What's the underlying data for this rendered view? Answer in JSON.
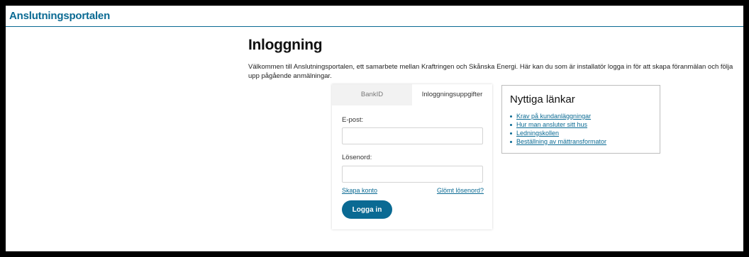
{
  "header": {
    "brand": "Anslutningsportalen"
  },
  "main": {
    "title": "Inloggning",
    "intro": "Välkommen till Anslutningsportalen, ett samarbete mellan Kraftringen och Skånska Energi. Här kan du som är installatör logga in för att skapa föranmälan och följa upp pågående anmälningar."
  },
  "login": {
    "tabs": [
      "BankID",
      "Inloggningsuppgifter"
    ],
    "active_tab": "Inloggningsuppgifter",
    "email_label": "E-post:",
    "email_value": "",
    "password_label": "Lösenord:",
    "password_value": "",
    "create_account": "Skapa konto",
    "forgot_password": "Glömt lösenord?",
    "submit": "Logga in"
  },
  "useful_links": {
    "title": "Nyttiga länkar",
    "items": [
      "Krav på kundanläggningar",
      "Hur man ansluter sitt hus",
      "Ledningskollen",
      "Beställning av mättransformator"
    ]
  },
  "colors": {
    "brand": "#0a6a93",
    "tab_inactive_bg": "#f2f2f2",
    "frame": "#000000"
  }
}
